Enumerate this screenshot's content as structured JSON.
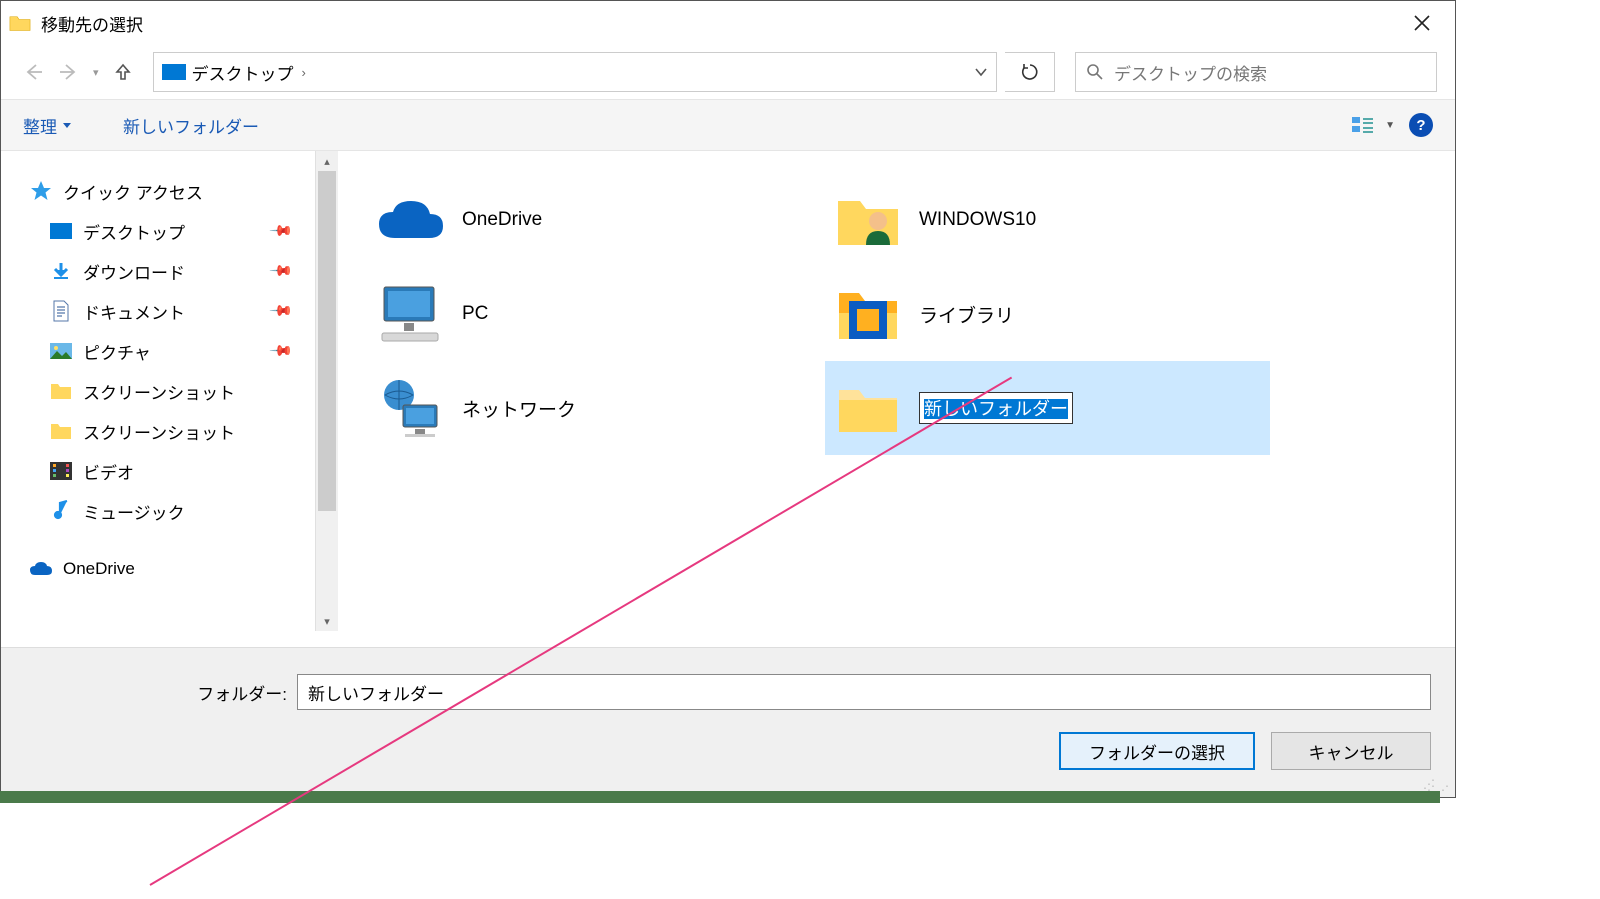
{
  "title": "移動先の選択",
  "address": {
    "location": "デスクトップ"
  },
  "search": {
    "placeholder": "デスクトップの検索"
  },
  "toolbar": {
    "organize": "整理",
    "newFolder": "新しいフォルダー"
  },
  "sidebar": {
    "quickAccess": "クイック アクセス",
    "items": [
      {
        "label": "デスクトップ",
        "pinned": true
      },
      {
        "label": "ダウンロード",
        "pinned": true
      },
      {
        "label": "ドキュメント",
        "pinned": true
      },
      {
        "label": "ピクチャ",
        "pinned": true
      },
      {
        "label": "スクリーンショット",
        "pinned": false
      },
      {
        "label": "スクリーンショット",
        "pinned": false
      },
      {
        "label": "ビデオ",
        "pinned": false
      },
      {
        "label": "ミュージック",
        "pinned": false
      }
    ],
    "onedrive": "OneDrive"
  },
  "tiles": [
    {
      "label": "OneDrive"
    },
    {
      "label": "WINDOWS10"
    },
    {
      "label": "PC"
    },
    {
      "label": "ライブラリ"
    },
    {
      "label": "ネットワーク"
    },
    {
      "label": "新しいフォルダー",
      "editing": true,
      "selected": true
    }
  ],
  "bottom": {
    "folderLabel": "フォルダー:",
    "folderValue": "新しいフォルダー",
    "selectBtn": "フォルダーの選択",
    "cancelBtn": "キャンセル"
  }
}
